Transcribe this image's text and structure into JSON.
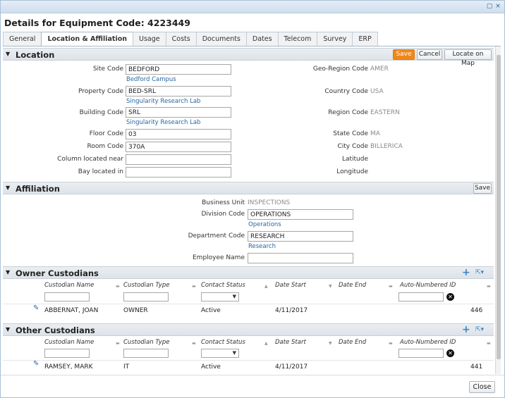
{
  "window": {
    "close_glyph": "×",
    "restore_glyph": "▢"
  },
  "header": {
    "title": "Details for Equipment Code: 4223449"
  },
  "tabs": [
    {
      "label": "General"
    },
    {
      "label": "Location & Affiliation"
    },
    {
      "label": "Usage"
    },
    {
      "label": "Costs"
    },
    {
      "label": "Documents"
    },
    {
      "label": "Dates"
    },
    {
      "label": "Telecom"
    },
    {
      "label": "Survey"
    },
    {
      "label": "ERP"
    }
  ],
  "location": {
    "title": "Location",
    "save": "Save",
    "cancel": "Cancel",
    "map": "Locate on Map",
    "site_code": {
      "label": "Site Code",
      "value": "BEDFORD",
      "link": "Bedford Campus"
    },
    "property_code": {
      "label": "Property Code",
      "value": "BED-SRL",
      "link": "Singularity Research Lab"
    },
    "building_code": {
      "label": "Building Code",
      "value": "SRL",
      "link": "Singularity Research Lab"
    },
    "floor_code": {
      "label": "Floor Code",
      "value": "03"
    },
    "room_code": {
      "label": "Room Code",
      "value": "370A"
    },
    "column": {
      "label": "Column located near",
      "value": ""
    },
    "bay": {
      "label": "Bay located in",
      "value": ""
    },
    "geo_region": {
      "label": "Geo-Region Code",
      "value": "AMER"
    },
    "country": {
      "label": "Country Code",
      "value": "USA"
    },
    "region": {
      "label": "Region Code",
      "value": "EASTERN"
    },
    "state": {
      "label": "State Code",
      "value": "MA"
    },
    "city": {
      "label": "City Code",
      "value": "BILLERICA"
    },
    "latitude": {
      "label": "Latitude",
      "value": ""
    },
    "longitude": {
      "label": "Longitude",
      "value": ""
    }
  },
  "affiliation": {
    "title": "Affiliation",
    "save": "Save",
    "business_unit": {
      "label": "Business Unit",
      "value": "INSPECTIONS"
    },
    "division": {
      "label": "Division Code",
      "value": "OPERATIONS",
      "link": "Operations"
    },
    "department": {
      "label": "Department Code",
      "value": "RESEARCH",
      "link": "Research"
    },
    "employee": {
      "label": "Employee Name",
      "value": ""
    }
  },
  "columns": [
    "Custodian Name",
    "Custodian Type",
    "Contact Status",
    "Date Start",
    "Date End",
    "Auto-Numbered ID"
  ],
  "owner": {
    "title": "Owner Custodians",
    "row": {
      "name": "ABBERNAT, JOAN",
      "type": "OWNER",
      "status": "Active",
      "start": "4/11/2017",
      "end": "",
      "id": "446"
    }
  },
  "other": {
    "title": "Other Custodians",
    "row": {
      "name": "RAMSEY, MARK",
      "type": "IT",
      "status": "Active",
      "start": "4/11/2017",
      "end": "",
      "id": "441"
    }
  },
  "footer": {
    "close": "Close"
  },
  "colors": {
    "accent": "#f0871a",
    "link": "#2b66a3",
    "header_bg": "#dde3e9"
  }
}
